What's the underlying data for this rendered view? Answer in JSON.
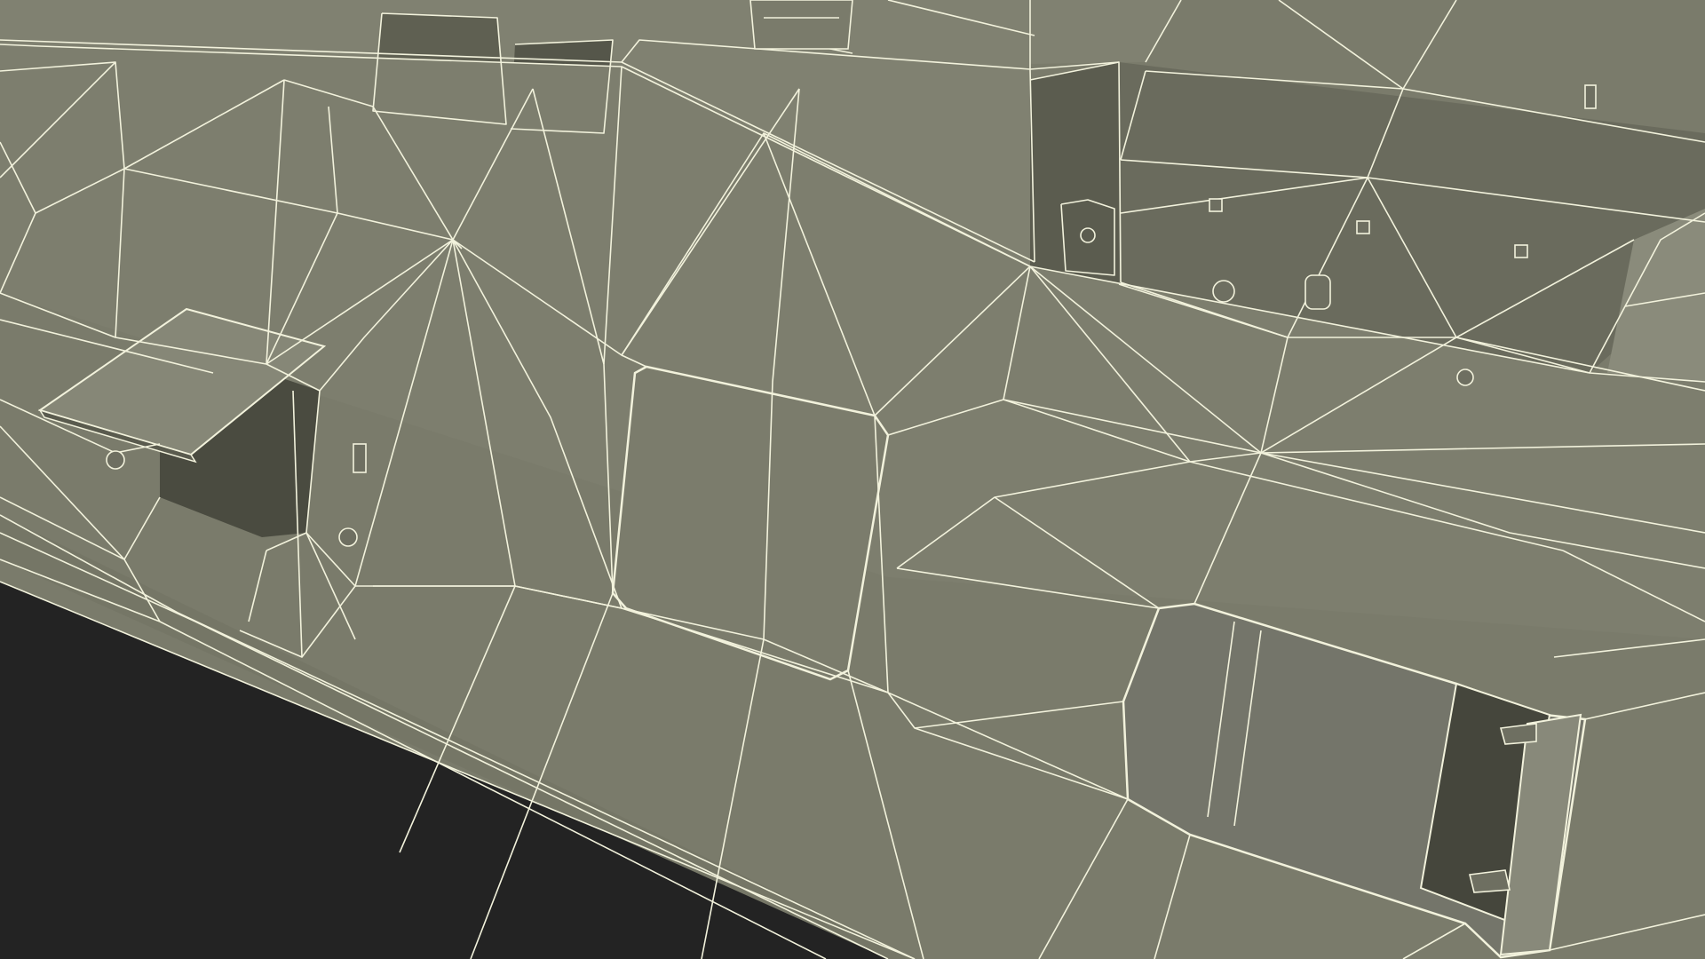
{
  "scene": {
    "subject": "ship-hull-wireframe",
    "colors": {
      "background": "#232323",
      "hull": "#7a7b6b",
      "hull_light": "#838474",
      "hull_dark": "#6c6d5e",
      "recess": "#55564a",
      "recess_dark": "#45463c",
      "wire": "#f2f2dc"
    }
  }
}
